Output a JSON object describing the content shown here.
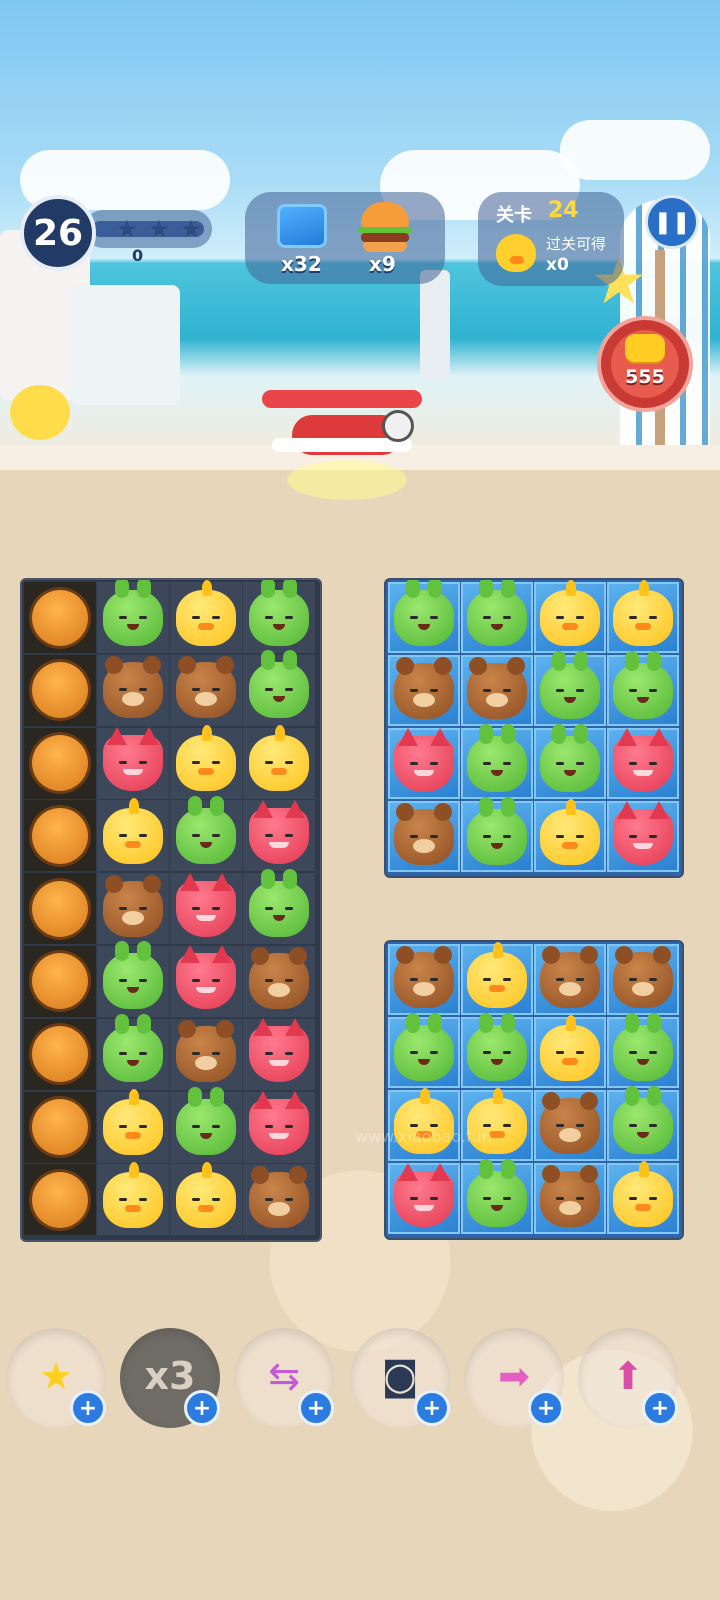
{
  "hud": {
    "moves": "26",
    "score": "0",
    "stars_filled": 0,
    "stars_total": 3,
    "goals": [
      {
        "icon": "blue-block-icon",
        "count": "x32"
      },
      {
        "icon": "burger-icon",
        "count": "x9"
      }
    ],
    "level_label": "关卡",
    "level_number": "24",
    "reward_label": "过关可得",
    "reward_count": "x0",
    "coins": "555"
  },
  "boards": {
    "left": [
      [
        "cookie",
        "frog",
        "chick",
        "frog"
      ],
      [
        "cookie",
        "bear",
        "bear",
        "frog"
      ],
      [
        "cookie",
        "fox",
        "chick",
        "chick"
      ],
      [
        "cookie",
        "chick",
        "frog",
        "fox"
      ],
      [
        "cookie",
        "bear",
        "fox",
        "frog"
      ],
      [
        "cookie",
        "frog",
        "fox",
        "bear"
      ],
      [
        "cookie",
        "frog",
        "bear",
        "fox"
      ],
      [
        "cookie",
        "chick",
        "frog",
        "fox"
      ],
      [
        "cookie",
        "chick",
        "chick",
        "bear"
      ]
    ],
    "top_right": [
      [
        "frog",
        "frog",
        "chick",
        "chick"
      ],
      [
        "bear",
        "bear",
        "frog",
        "frog"
      ],
      [
        "fox",
        "frog",
        "frog",
        "fox"
      ],
      [
        "bear",
        "frog",
        "chick",
        "fox"
      ]
    ],
    "bottom_right": [
      [
        "bear",
        "chick",
        "bear",
        "bear"
      ],
      [
        "frog",
        "frog",
        "chick",
        "frog"
      ],
      [
        "chick",
        "chick",
        "bear",
        "frog"
      ],
      [
        "fox",
        "frog",
        "bear",
        "chick"
      ]
    ]
  },
  "boosters": [
    {
      "name": "star-wand-booster",
      "icon": "star-wand-icon",
      "glyph": "★",
      "dim": false
    },
    {
      "name": "glove-x3-booster",
      "icon": "glove-icon",
      "glyph": "x3",
      "dim": true
    },
    {
      "name": "swap-booster",
      "icon": "swap-arrows-icon",
      "glyph": "⇆",
      "dim": false
    },
    {
      "name": "goggles-booster",
      "icon": "goggles-icon",
      "glyph": "◙",
      "dim": false
    },
    {
      "name": "rocket-right-booster",
      "icon": "rocket-right-icon",
      "glyph": "➡",
      "dim": false
    },
    {
      "name": "rocket-up-booster",
      "icon": "rocket-up-icon",
      "glyph": "⬆",
      "dim": false
    }
  ],
  "booster_plus": "+",
  "watermark": "www.xiaobao.fun"
}
